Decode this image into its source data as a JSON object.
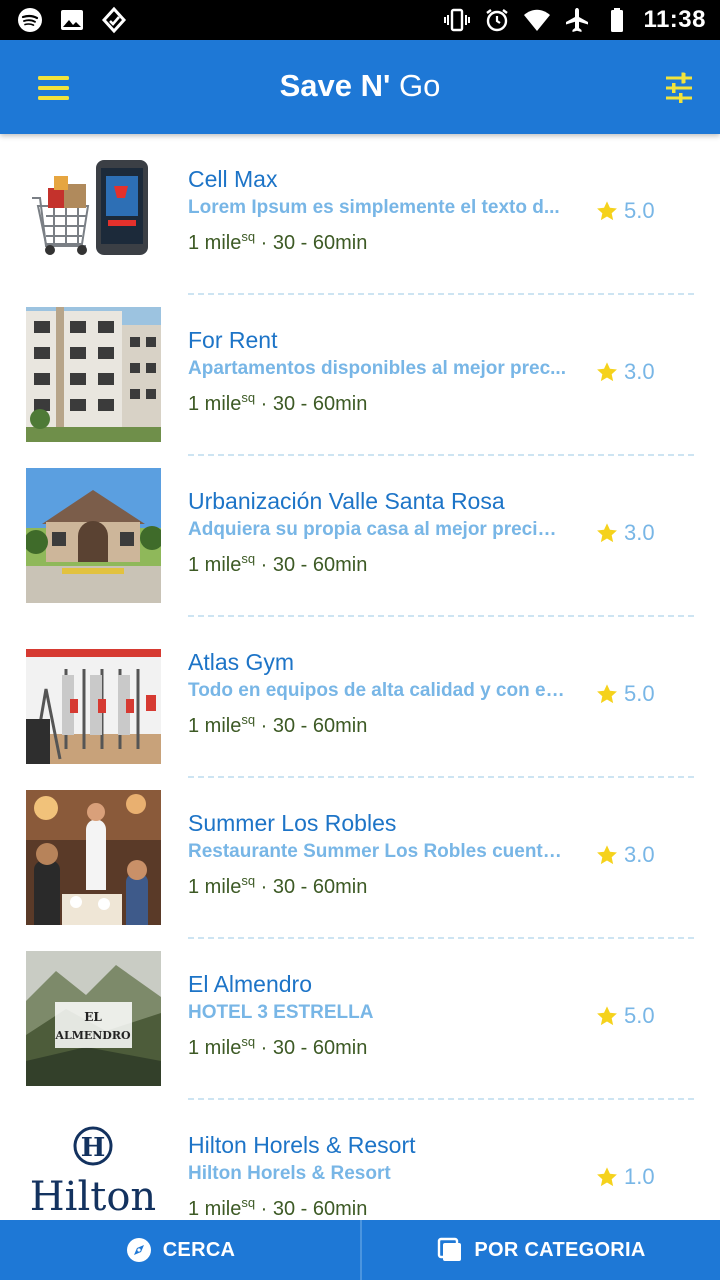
{
  "status_bar": {
    "time": "11:38"
  },
  "app_bar": {
    "title_bold": "Save N'",
    "title_normal": "Go",
    "accent_color": "#f2e33b",
    "background": "#1e78d6"
  },
  "items": [
    {
      "name": "Cell Max",
      "description": "Lorem Ipsum es simplemente el texto d...",
      "distance": "1 mile",
      "distance_unit": "sq",
      "time": "· 30 - 60min",
      "rating": "5.0",
      "image": "phone-shopping-cart"
    },
    {
      "name": "For Rent",
      "description": "Apartamentos disponibles al mejor prec...",
      "distance": "1 mile",
      "distance_unit": "sq",
      "time": "· 30 - 60min",
      "rating": "3.0",
      "image": "apartment-building"
    },
    {
      "name": "Urbanización Valle Santa Rosa",
      "description": "Adquiera su propia casa al mejor precio,...",
      "distance": "1 mile",
      "distance_unit": "sq",
      "time": "· 30 - 60min",
      "rating": "3.0",
      "image": "house"
    },
    {
      "name": "Atlas Gym",
      "description": "Todo en equipos de alta calidad y con el ...",
      "distance": "1 mile",
      "distance_unit": "sq",
      "time": "· 30 - 60min",
      "rating": "5.0",
      "image": "gym-interior"
    },
    {
      "name": "Summer Los Robles",
      "description": "Restaurante Summer Los Robles cuenta...",
      "distance": "1 mile",
      "distance_unit": "sq",
      "time": "· 30 - 60min",
      "rating": "3.0",
      "image": "restaurant"
    },
    {
      "name": "El Almendro",
      "description": "HOTEL 3 ESTRELLA",
      "distance": "1 mile",
      "distance_unit": "sq",
      "time": "· 30 - 60min",
      "rating": "5.0",
      "image": "el-almendro-logo",
      "logo_line1": "EL",
      "logo_line2": "ALMENDRO"
    },
    {
      "name": "Hilton Horels & Resort",
      "description": "Hilton Horels & Resort",
      "distance": "1 mile",
      "distance_unit": "sq",
      "time": "· 30 - 60min",
      "rating": "1.0",
      "image": "hilton-logo",
      "logo_text": "Hilton"
    }
  ],
  "bottom_nav": {
    "tabs": [
      {
        "label": "CERCA",
        "icon": "compass-icon"
      },
      {
        "label": "POR CATEGORIA",
        "icon": "category-icon"
      }
    ]
  },
  "colors": {
    "title": "#1d74c7",
    "description": "#78b6e6",
    "meta": "#3d5a25",
    "star": "#f5d21c"
  }
}
